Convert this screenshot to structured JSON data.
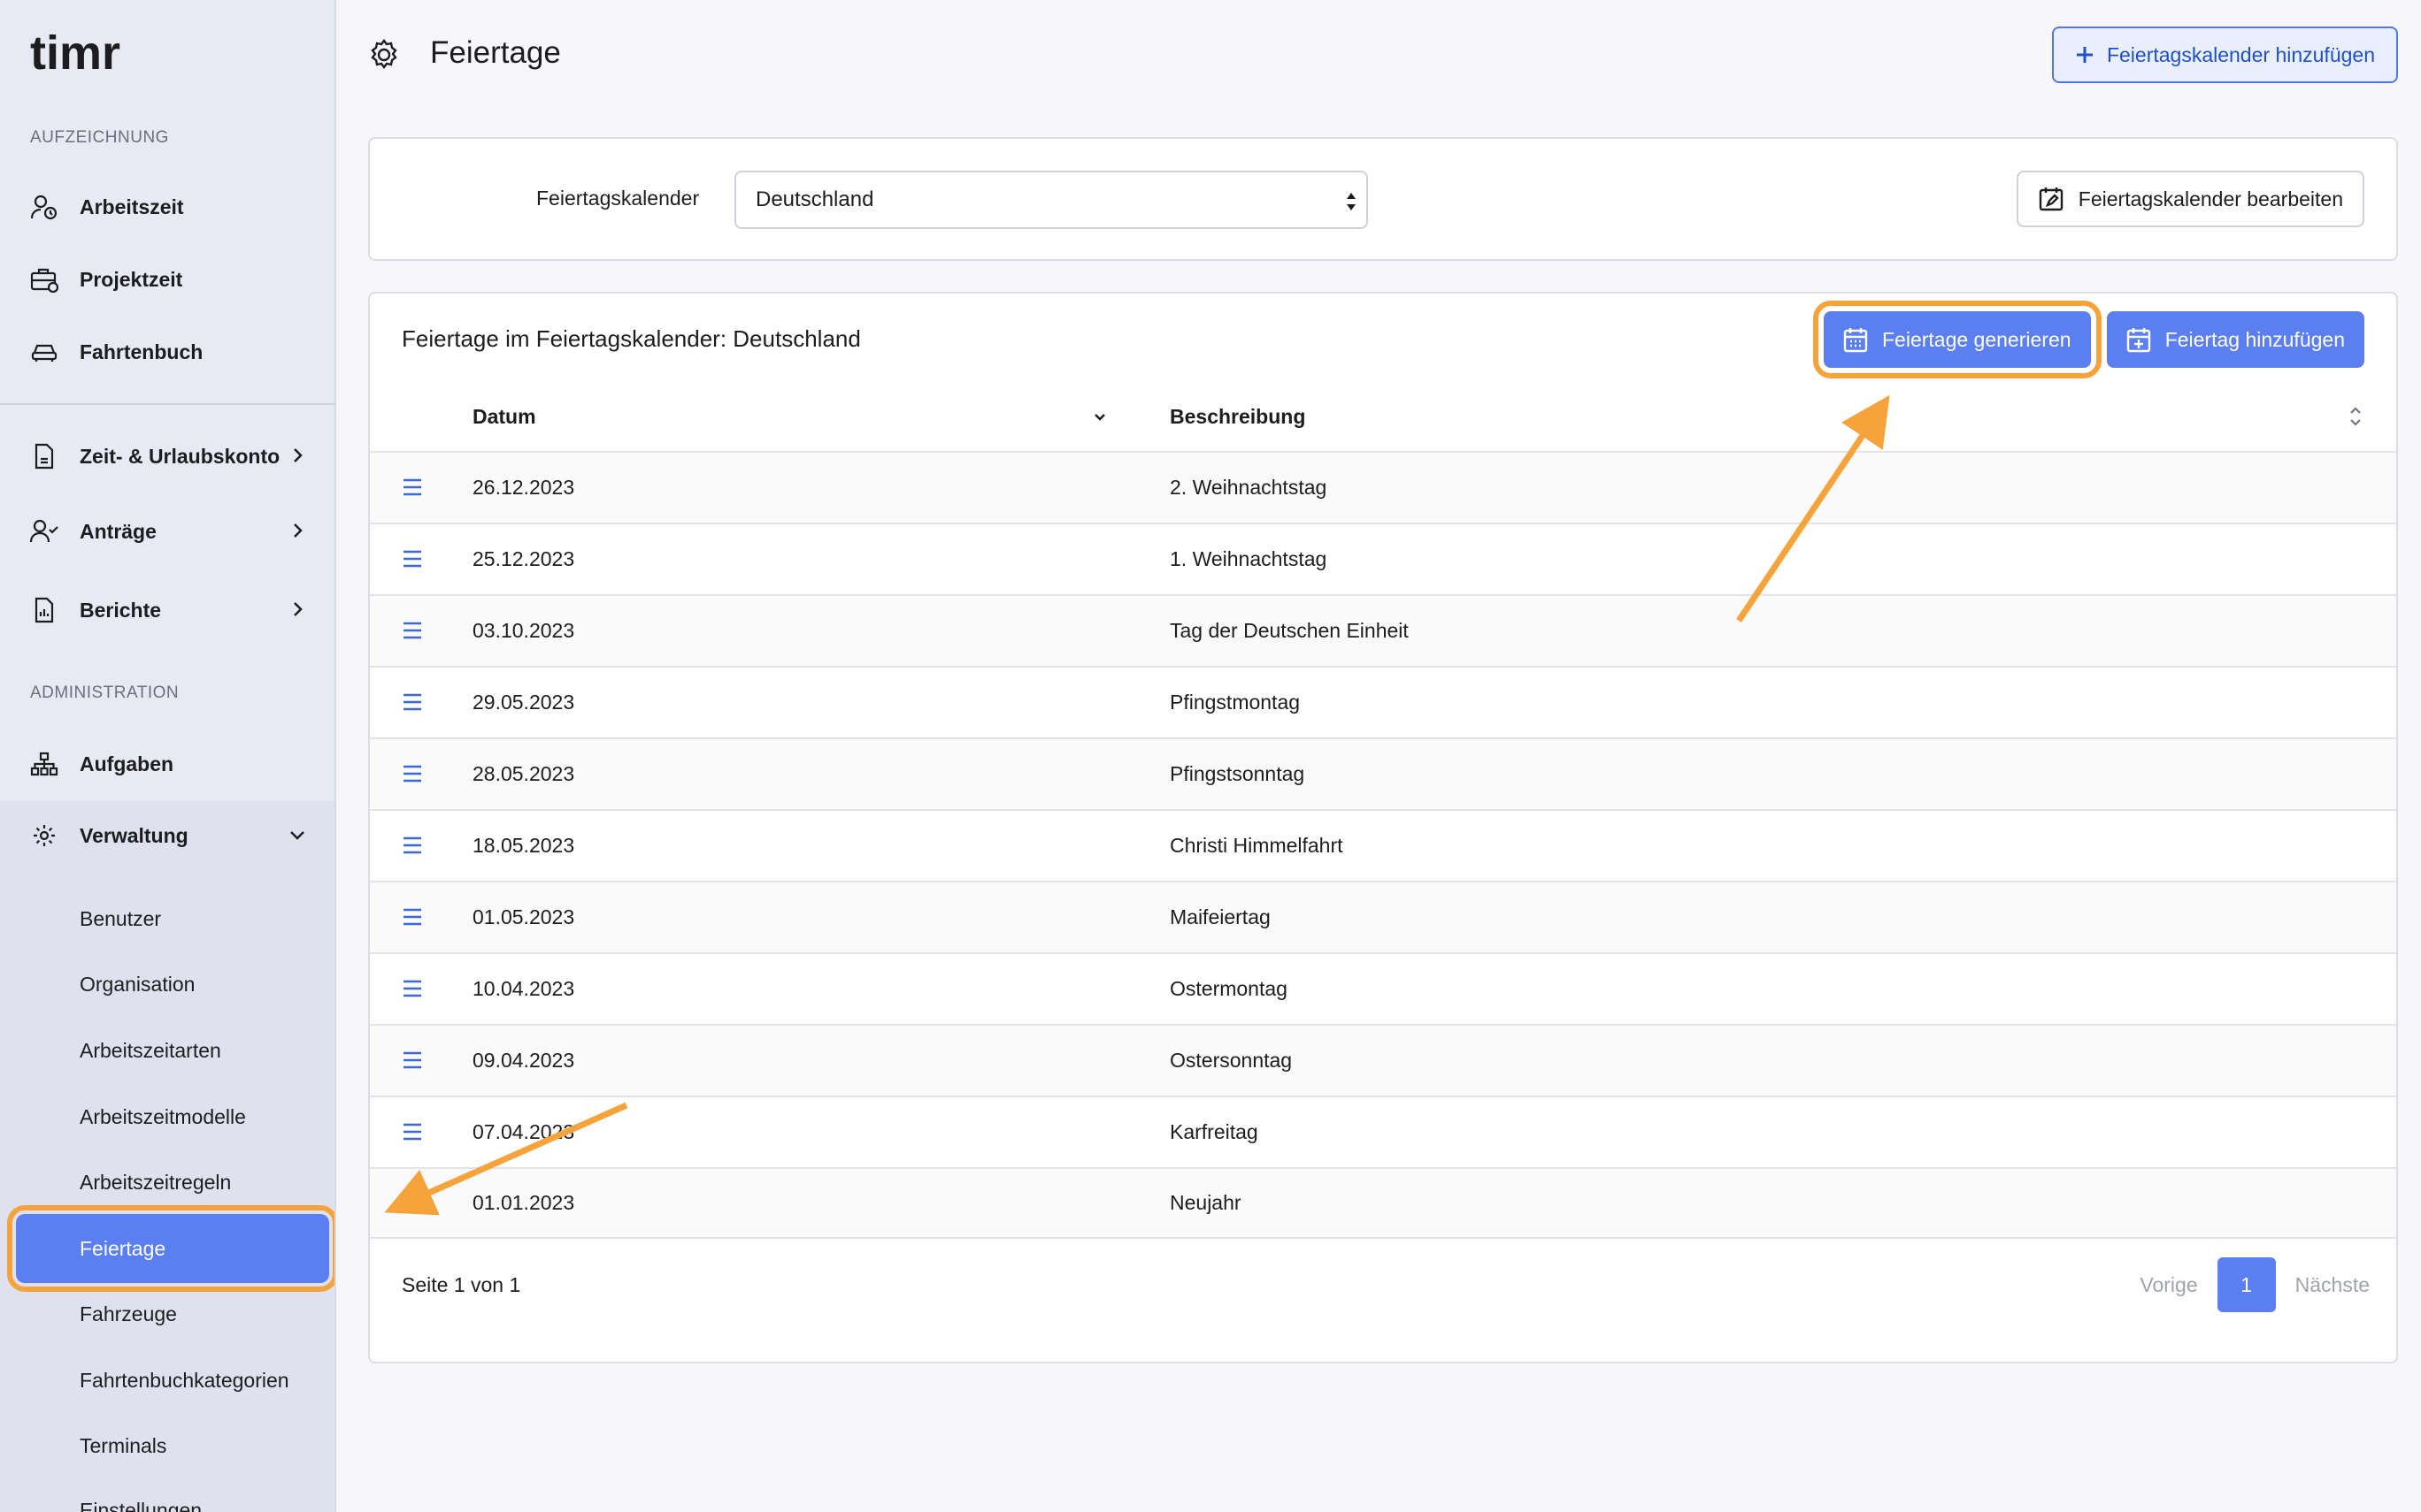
{
  "brand": {
    "logo_text": "timr"
  },
  "sidebar": {
    "section_recording": "AUFZEICHNUNG",
    "recording_items": [
      {
        "label": "Arbeitszeit",
        "icon": "user-clock-icon"
      },
      {
        "label": "Projektzeit",
        "icon": "briefcase-icon"
      },
      {
        "label": "Fahrtenbuch",
        "icon": "car-icon"
      }
    ],
    "account_items": [
      {
        "label": "Zeit- & Urlaubskonto",
        "icon": "document-icon"
      },
      {
        "label": "Anträge",
        "icon": "user-check-icon"
      },
      {
        "label": "Berichte",
        "icon": "report-icon"
      }
    ],
    "section_admin": "ADMINISTRATION",
    "admin_items": [
      {
        "label": "Aufgaben",
        "icon": "hierarchy-icon"
      },
      {
        "label": "Verwaltung",
        "icon": "gear-icon"
      }
    ],
    "verwaltung_subitems": [
      "Benutzer",
      "Organisation",
      "Arbeitszeitarten",
      "Arbeitszeitmodelle",
      "Arbeitszeitregeln",
      "Feiertage",
      "Fahrzeuge",
      "Fahrtenbuchkategorien",
      "Terminals",
      "Einstellungen"
    ],
    "active_subitem": "Feiertage"
  },
  "header": {
    "title": "Feiertage",
    "add_calendar_button": "Feiertagskalender hinzufügen"
  },
  "calendar_select": {
    "label": "Feiertagskalender",
    "selected": "Deutschland",
    "edit_button": "Feiertagskalender bearbeiten"
  },
  "holidays": {
    "title": "Feiertage im Feiertagskalender: Deutschland",
    "generate_button": "Feiertage generieren",
    "add_button": "Feiertag hinzufügen",
    "columns": {
      "date": "Datum",
      "description": "Beschreibung"
    },
    "rows": [
      {
        "date": "26.12.2023",
        "description": "2. Weihnachtstag"
      },
      {
        "date": "25.12.2023",
        "description": "1. Weihnachtstag"
      },
      {
        "date": "03.10.2023",
        "description": "Tag der Deutschen Einheit"
      },
      {
        "date": "29.05.2023",
        "description": "Pfingstmontag"
      },
      {
        "date": "28.05.2023",
        "description": "Pfingstsonntag"
      },
      {
        "date": "18.05.2023",
        "description": "Christi Himmelfahrt"
      },
      {
        "date": "01.05.2023",
        "description": "Maifeiertag"
      },
      {
        "date": "10.04.2023",
        "description": "Ostermontag"
      },
      {
        "date": "09.04.2023",
        "description": "Ostersonntag"
      },
      {
        "date": "07.04.2023",
        "description": "Karfreitag"
      },
      {
        "date": "01.01.2023",
        "description": "Neujahr"
      }
    ],
    "pagination": {
      "summary": "Seite 1 von 1",
      "prev": "Vorige",
      "current": "1",
      "next": "Nächste"
    }
  },
  "colors": {
    "accent": "#5b7ef0",
    "highlight": "#f5a33a",
    "sidebar_bg": "#e8eaf3"
  }
}
